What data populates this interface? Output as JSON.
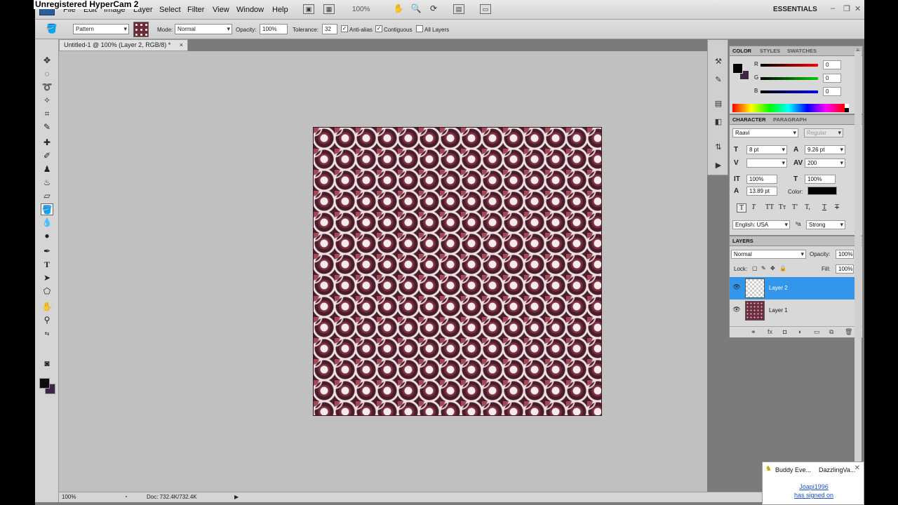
{
  "watermark": "Unregistered HyperCam 2",
  "menubar": {
    "items": [
      "File",
      "Edit",
      "Image",
      "Layer",
      "Select",
      "Filter",
      "View",
      "Window",
      "Help"
    ],
    "zoom": "100%",
    "workspace": "ESSENTIALS"
  },
  "options": {
    "fill_source": "Pattern",
    "mode_label": "Mode:",
    "mode_value": "Normal",
    "opacity_label": "Opacity:",
    "opacity_value": "100%",
    "tolerance_label": "Tolerance:",
    "tolerance_value": "32",
    "anti_alias_label": "Anti-alias",
    "contiguous_label": "Contiguous",
    "all_layers_label": "All Layers"
  },
  "document": {
    "tab_title": "Untitled-1 @ 100% (Layer 2, RGB/8) *",
    "close": "×"
  },
  "status": {
    "zoom": "100%",
    "doc": "Doc: 732.4K/732.4K"
  },
  "color_panel": {
    "tabs": [
      "COLOR",
      "STYLES",
      "SWATCHES"
    ],
    "r_label": "R",
    "g_label": "G",
    "b_label": "B",
    "r": "0",
    "g": "0",
    "b": "0"
  },
  "character_panel": {
    "tabs": [
      "CHARACTER",
      "PARAGRAPH"
    ],
    "font_family": "Raavi",
    "font_style": "Regular",
    "font_size": "8 pt",
    "leading": "9.26 pt",
    "kerning": "",
    "tracking": "200",
    "vertical_scale": "100%",
    "horizontal_scale": "100%",
    "baseline_shift": "13.89 pt",
    "color_label": "Color:",
    "language": "English: USA",
    "antialias_icon": "ªa",
    "antialias": "Strong",
    "style_buttons": [
      "T",
      "T",
      "TT",
      "Tт",
      "T'",
      "T,",
      "T",
      "T"
    ]
  },
  "layers_panel": {
    "tab": "LAYERS",
    "blend_mode": "Normal",
    "opacity_label": "Opacity:",
    "opacity": "100%",
    "lock_label": "Lock:",
    "fill_label": "Fill:",
    "fill": "100%",
    "layers": [
      {
        "name": "Layer 2",
        "selected": true
      },
      {
        "name": "Layer 1",
        "selected": false
      }
    ]
  },
  "notification": {
    "title": "Buddy Eve...",
    "user": "DazzlingVa...",
    "line1": "Joapi1996",
    "line2": "has signed on"
  },
  "colors": {
    "foreground": "#000000",
    "background": "#3d2747",
    "selection": "#3296ea"
  }
}
